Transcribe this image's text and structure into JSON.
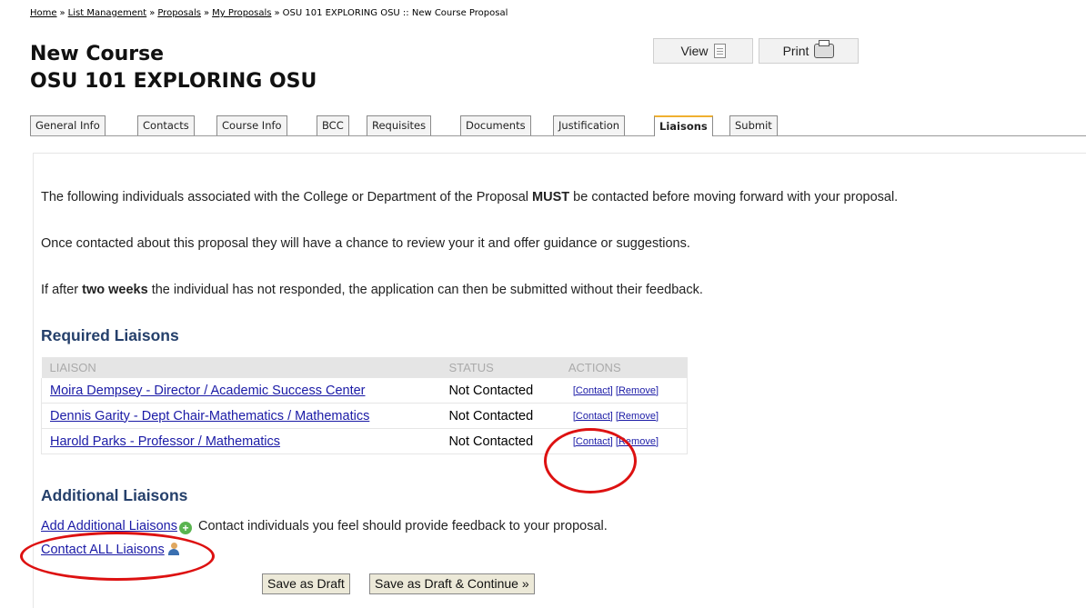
{
  "breadcrumb": {
    "items": [
      "Home",
      "List Management",
      "Proposals",
      "My Proposals"
    ],
    "current": "OSU 101 EXPLORING OSU :: New Course Proposal",
    "separator": "»"
  },
  "header": {
    "title_line1": "New Course",
    "title_line2": "OSU 101 EXPLORING OSU",
    "view_label": "View",
    "print_label": "Print"
  },
  "tabs": [
    {
      "label": "General Info"
    },
    {
      "label": "Contacts"
    },
    {
      "label": "Course Info"
    },
    {
      "label": "BCC"
    },
    {
      "label": "Requisites"
    },
    {
      "label": "Documents"
    },
    {
      "label": "Justification"
    },
    {
      "label": "Liaisons",
      "active": true
    },
    {
      "label": "Submit"
    }
  ],
  "intro": {
    "p1_before": "The following individuals associated with the College or Department of the Proposal",
    "p1_bold": "MUST",
    "p1_after": "be contacted before moving forward with your proposal.",
    "p2": "Once contacted about this proposal they will have a chance to review your it and offer guidance or suggestions.",
    "p3_before": "If after",
    "p3_bold": "two weeks",
    "p3_after": "the individual has not responded, the application can then be submitted without their feedback."
  },
  "required": {
    "heading": "Required Liaisons",
    "columns": [
      "LIAISON",
      "STATUS",
      "ACTIONS"
    ],
    "rows": [
      {
        "name": "Moira Dempsey - Director / Academic Success Center",
        "status": "Not Contacted",
        "contact": "[Contact]",
        "remove": "[Remove]"
      },
      {
        "name": "Dennis Garity - Dept Chair-Mathematics / Mathematics",
        "status": "Not Contacted",
        "contact": "[Contact]",
        "remove": "[Remove]"
      },
      {
        "name": "Harold Parks - Professor / Mathematics",
        "status": "Not Contacted",
        "contact": "[Contact]",
        "remove": "[Remove]"
      }
    ]
  },
  "additional": {
    "heading": "Additional Liaisons",
    "add_link": "Add Additional Liaisons",
    "add_desc": "Contact individuals you feel should provide feedback to your proposal.",
    "contact_all": "Contact ALL Liaisons"
  },
  "actions": {
    "save_draft": "Save as Draft",
    "save_continue": "Save as Draft & Continue »"
  },
  "colors": {
    "heading": "#25406b",
    "link": "#1a1aa6",
    "annotation": "#dd1111",
    "active_tab_accent": "#f0b030"
  },
  "icons": [
    "document-icon",
    "printer-icon",
    "plus-circle-icon",
    "people-icon"
  ]
}
